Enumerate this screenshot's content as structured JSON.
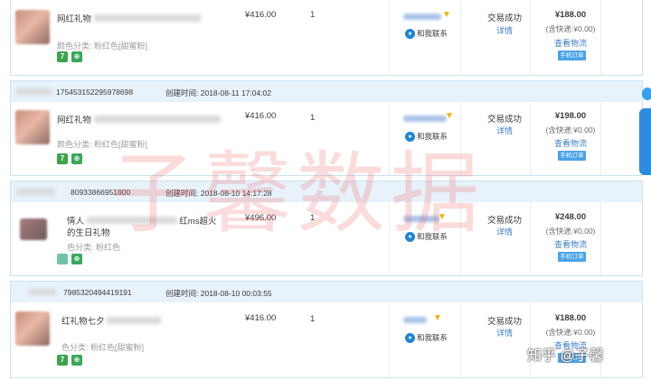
{
  "labels": {
    "created_prefix": "创建时间: ",
    "contact": "和我联系",
    "detail": "详情",
    "logistics": "查看物流",
    "manual_btn": "手机订单",
    "shipping": "(含快递:¥0.00)"
  },
  "orders": [
    {
      "order_no": "",
      "created_time": "",
      "title": "网红礼物",
      "title_tail": "",
      "spec": "颜色分类: 粉红色[甜蜜粉]",
      "price": "¥416.00",
      "qty": "1",
      "status": "交易成功",
      "total": "¥188.00"
    },
    {
      "order_no": "175453152295978698",
      "created_time": "2018-08-11 17:04:02",
      "title": "网红礼物",
      "title_tail": "",
      "spec": "颜色分类: 粉红色[甜蜜粉]",
      "price": "¥416.00",
      "qty": "1",
      "status": "交易成功",
      "total": "¥198.00"
    },
    {
      "order_no": "80933866951800",
      "created_time": "2018-08-10 14:17:28",
      "title": "情人",
      "title_tail": "红ms超火",
      "title_line2": "的生日礼物",
      "spec": "色分类: 粉红色",
      "price": "¥496.00",
      "qty": "1",
      "status": "交易成功",
      "total": "¥248.00"
    },
    {
      "order_no": "7985320494419191",
      "created_time": "2018-08-10 00:03:55",
      "title": "红礼物七夕",
      "title_tail": "",
      "spec": "色分类: 粉红色[甜蜜粉]",
      "price": "¥416.00",
      "qty": "1",
      "status": "交易成功",
      "total": "¥188.00"
    }
  ],
  "watermark": "子馨数据",
  "credit": "知乎 @子馨",
  "colors": {
    "accent": "#3c7cc9",
    "header_bg": "#e8f2fb",
    "button": "#4aa3e8"
  }
}
